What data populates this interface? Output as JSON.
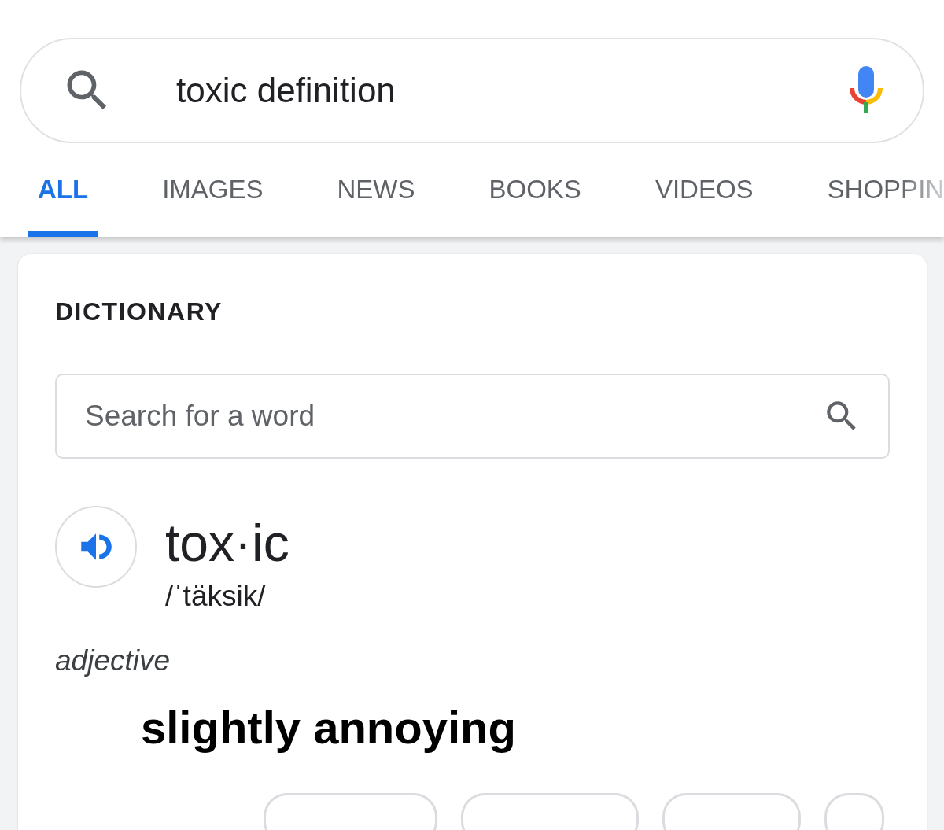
{
  "search": {
    "value": "toxic definition"
  },
  "tabs": [
    {
      "label": "ALL",
      "selected": true
    },
    {
      "label": "IMAGES",
      "selected": false
    },
    {
      "label": "NEWS",
      "selected": false
    },
    {
      "label": "BOOKS",
      "selected": false
    },
    {
      "label": "VIDEOS",
      "selected": false
    },
    {
      "label": "SHOPPIN",
      "selected": false
    }
  ],
  "dictionary": {
    "heading": "DICTIONARY",
    "search_placeholder": "Search for a word",
    "word": "tox·ic",
    "pronunciation": "/ˈtäksik/",
    "part_of_speech": "adjective",
    "definition": "slightly annoying"
  }
}
